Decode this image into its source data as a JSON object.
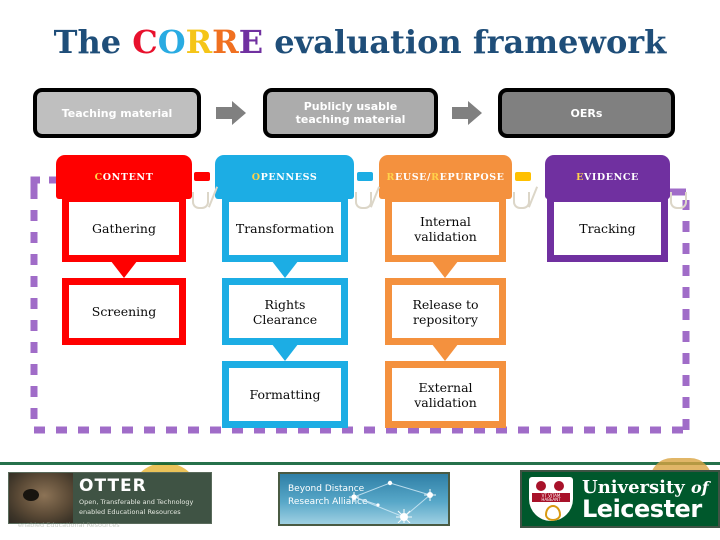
{
  "title": {
    "prefix": "The ",
    "acronym": [
      {
        "char": "C",
        "color": "#E8112D"
      },
      {
        "char": "O",
        "color": "#29ABE2"
      },
      {
        "char": "R",
        "color": "#F5C518"
      },
      {
        "char": "R",
        "color": "#F07020"
      },
      {
        "char": "E",
        "color": "#7030A0"
      }
    ],
    "suffix": " evaluation framework",
    "base_color": "#1F4E79"
  },
  "flow_row": {
    "boxes": [
      {
        "label": "Teaching material",
        "fill": "#BFBFBF"
      },
      {
        "label": "Publicly usable\nteaching material",
        "line1": "Publicly usable",
        "line2": "teaching material",
        "fill": "#ACACAC"
      },
      {
        "label": "OERs",
        "fill": "#808080"
      }
    ],
    "arrow_color": "#808080",
    "arrow_count": 2
  },
  "columns": [
    {
      "header": "CONTENT",
      "header_initial": "C",
      "header_rest": "ONTENT",
      "color": "#FF0000",
      "cells": [
        "Gathering",
        "Screening"
      ]
    },
    {
      "header": "OPENNESS",
      "header_initial": "O",
      "header_rest": "PENNESS",
      "color": "#1CADE4",
      "cells": [
        "Transformation",
        "Rights\nClearance",
        "Formatting"
      ],
      "cells_lines": [
        [
          "Transformation"
        ],
        [
          "Rights",
          "Clearance"
        ],
        [
          "Formatting"
        ]
      ]
    },
    {
      "header": "REUSE/REPURPOSE",
      "header_initial": "R",
      "header_rest": "EUSE/",
      "header_initial2": "R",
      "header_rest2": "EPURPOSE",
      "color": "#F4913E",
      "cells": [
        "Internal\nvalidation",
        "Release to\nrepository",
        "External\nvalidation"
      ],
      "cells_lines": [
        [
          "Internal",
          "validation"
        ],
        [
          "Release to",
          "repository"
        ],
        [
          "External",
          "validation"
        ]
      ]
    },
    {
      "header": "EVIDENCE",
      "header_initial": "E",
      "header_rest": "VIDENCE",
      "color": "#7030A0",
      "cells": [
        "Tracking"
      ]
    }
  ],
  "boundary": {
    "style": "dashed",
    "color": "#A06CC8",
    "note": "purple dashed loop enclosing the four columns with arrowhead into CONTENT"
  },
  "accent_initial_color": "#FFD24A",
  "logos": {
    "otter": {
      "name": "OTTER",
      "tagline_line1": "Open, Transferable and Technology",
      "tagline_line2": "enabled Educational Resources",
      "ghost_text": "enabled Educational Resources",
      "bg": "#3F5344"
    },
    "bdra": {
      "line1": "Beyond Distance",
      "line2": "Research Alliance"
    },
    "leicester": {
      "line1_a": "University ",
      "line1_b": "of",
      "line2": "Leicester",
      "crest_motto": "VT VITAM HABEANT",
      "bg": "#00582C"
    }
  }
}
